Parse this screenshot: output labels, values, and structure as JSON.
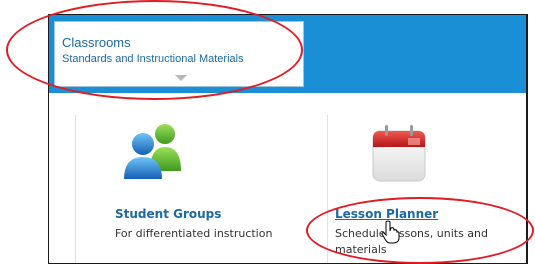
{
  "header": {
    "tab_title": "Classrooms",
    "tab_subtitle": "Standards and Instructional Materials"
  },
  "tiles": [
    {
      "title": "Student Groups",
      "description": "For differentiated instruction",
      "icon": "student-groups-icon"
    },
    {
      "title": "Lesson Planner",
      "description": "Schedule lessons, units and materials",
      "icon": "calendar-icon"
    }
  ],
  "colors": {
    "header_blue": "#1a8fd6",
    "link_blue": "#1c6aa0",
    "annotation_red": "#e21b25"
  }
}
